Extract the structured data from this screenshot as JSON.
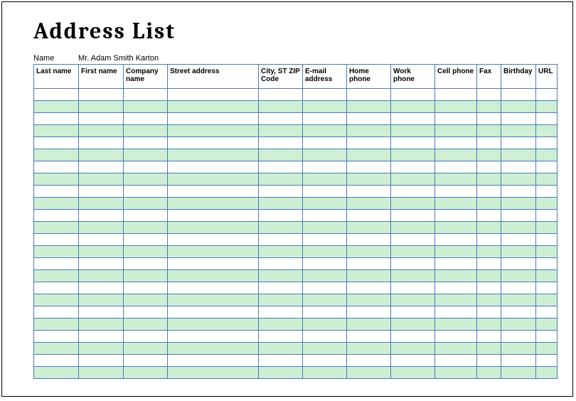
{
  "title": "Address List",
  "name_label": "Name",
  "name_value": "Mr. Adam Smith Karton",
  "columns": [
    "Last name",
    "First name",
    "Company name",
    "Street address",
    "City, ST  ZIP Code",
    "E-mail address",
    "Home phone",
    "Work phone",
    "Cell phone",
    "Fax",
    "Birthday",
    "URL"
  ],
  "row_count": 24
}
